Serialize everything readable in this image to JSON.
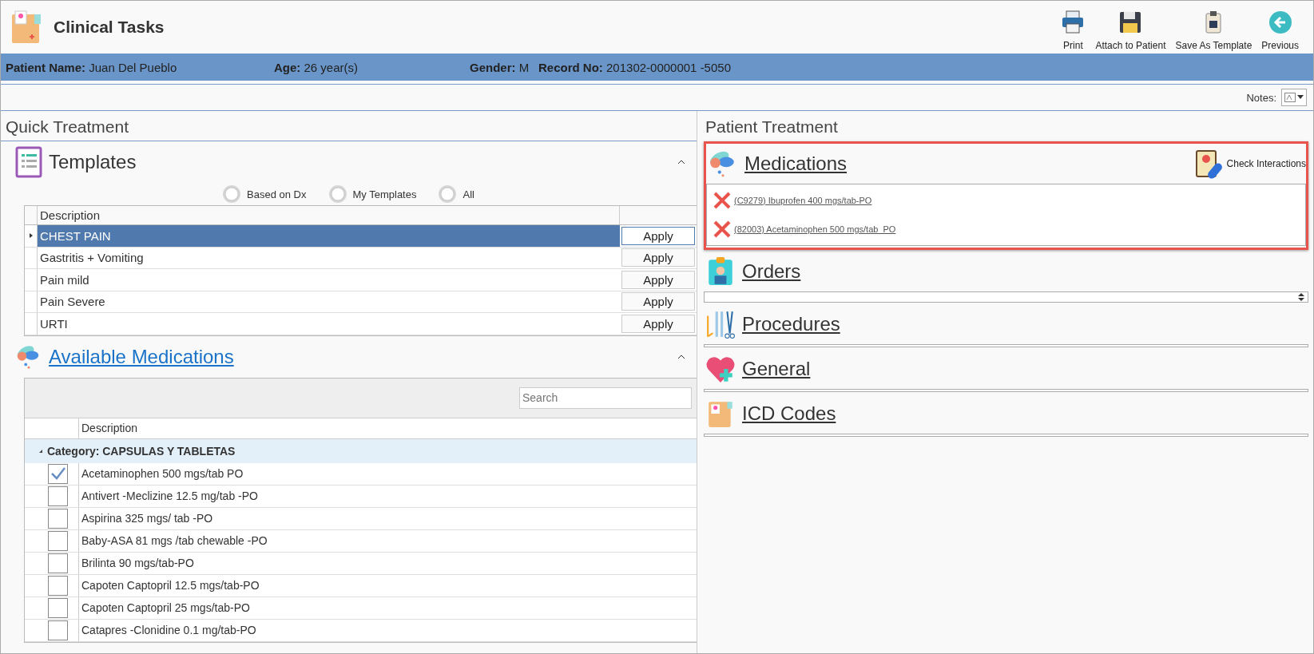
{
  "window": {
    "title": "Clinical Tasks"
  },
  "toolbar": [
    {
      "label": "Print",
      "kind": "print"
    },
    {
      "label": "Attach to Patient",
      "kind": "save"
    },
    {
      "label": "Save As Template",
      "kind": "template"
    },
    {
      "label": "Previous",
      "kind": "back"
    }
  ],
  "patient_bar": [
    {
      "label": "Patient Name:",
      "value": "Juan Del Pueblo"
    },
    {
      "label": "Age:",
      "value": "26 year(s)"
    },
    {
      "label": "Gender:",
      "value": "M"
    },
    {
      "label": "Record No:",
      "value": "201302-0000001 -5050"
    }
  ],
  "notes": {
    "label": "Notes:"
  },
  "quick_treatment": {
    "title": "Quick Treatment",
    "templates": {
      "title": "Templates",
      "filters": [
        {
          "label": "Based on Dx",
          "selected": false
        },
        {
          "label": "My Templates",
          "selected": false
        },
        {
          "label": "All",
          "selected": false
        }
      ],
      "column": "Description",
      "rows": [
        {
          "description": "CHEST PAIN",
          "selected": true,
          "action": "Apply"
        },
        {
          "description": "Gastritis + Vomiting",
          "selected": false,
          "action": "Apply"
        },
        {
          "description": "Pain mild",
          "selected": false,
          "action": "Apply"
        },
        {
          "description": "Pain Severe",
          "selected": false,
          "action": "Apply"
        },
        {
          "description": "URTI",
          "selected": false,
          "action": "Apply"
        }
      ]
    },
    "available_medications": {
      "title": "Available Medications",
      "search": {
        "placeholder": "Search"
      },
      "column": "Description",
      "group": "Category: CAPSULAS Y TABLETAS",
      "rows": [
        {
          "description": "Acetaminophen 500 mgs/tab PO",
          "checked": true
        },
        {
          "description": "Antivert -Meclizine 12.5 mg/tab -PO",
          "checked": false
        },
        {
          "description": "Aspirina 325 mgs/ tab -PO",
          "checked": false
        },
        {
          "description": "Baby-ASA 81 mgs /tab chewable -PO",
          "checked": false
        },
        {
          "description": "Brilinta 90 mgs/tab-PO",
          "checked": false
        },
        {
          "description": "Capoten Captopril 12.5 mgs/tab-PO",
          "checked": false
        },
        {
          "description": "Capoten Captopril 25 mgs/tab-PO",
          "checked": false
        },
        {
          "description": "Catapres -Clonidine 0.1 mg/tab-PO",
          "checked": false
        }
      ]
    }
  },
  "patient_treatment": {
    "title": "Patient Treatment",
    "sections": [
      {
        "title": "Medications",
        "kind": "medications",
        "highlighted": true,
        "action": "Check Interactions",
        "items": [
          "(C9279) Ibuprofen 400 mgs/tab-PO",
          "(82003) Acetaminophen 500 mgs/tab_PO"
        ]
      },
      {
        "title": "Orders",
        "kind": "orders",
        "highlighted": false
      },
      {
        "title": "Procedures",
        "kind": "procedures",
        "highlighted": false
      },
      {
        "title": "General",
        "kind": "general",
        "highlighted": false
      },
      {
        "title": "ICD Codes",
        "kind": "icd",
        "highlighted": false
      }
    ]
  }
}
